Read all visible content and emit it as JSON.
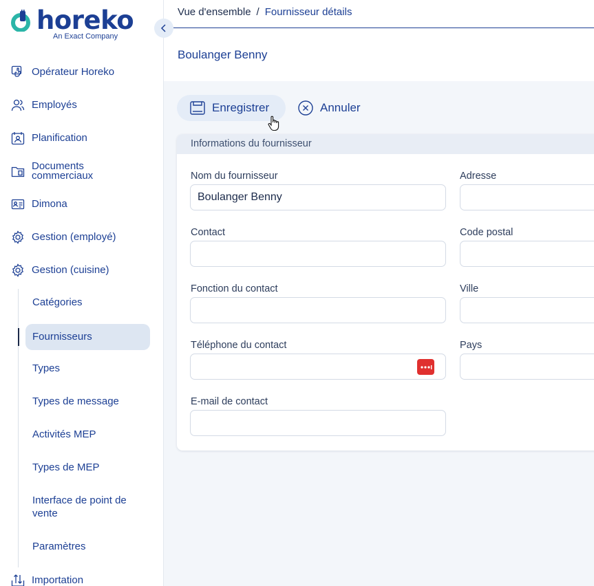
{
  "brand": {
    "name": "horeko",
    "tagline": "An Exact Company",
    "primary_color": "#1c3f94",
    "accent_color": "#2bb5a8"
  },
  "sidebar": {
    "items": [
      {
        "label": "Opérateur Horeko",
        "icon": "touch-icon"
      },
      {
        "label": "Employés",
        "icon": "users-icon"
      },
      {
        "label": "Planification",
        "icon": "calendar-user-icon"
      },
      {
        "label": "Documents commerciaux",
        "icon": "folder-icon"
      },
      {
        "label": "Dimona",
        "icon": "id-card-icon"
      },
      {
        "label": "Gestion (employé)",
        "icon": "user-gear-icon"
      },
      {
        "label": "Gestion (cuisine)",
        "icon": "chef-gear-icon"
      }
    ],
    "subitems": [
      {
        "label": "Catégories"
      },
      {
        "label": "Fournisseurs",
        "active": true
      },
      {
        "label": "Types"
      },
      {
        "label": "Types de message"
      },
      {
        "label": "Activités MEP"
      },
      {
        "label": "Types de MEP"
      },
      {
        "label": "Interface de point de vente"
      },
      {
        "label": "Paramètres"
      }
    ],
    "bottom_item": {
      "label": "Importation",
      "icon": "import-arrows-icon"
    }
  },
  "breadcrumb": {
    "root": "Vue d'ensemble",
    "separator": "/",
    "current": "Fournisseur détails"
  },
  "page": {
    "title": "Boulanger Benny"
  },
  "actions": {
    "save": "Enregistrer",
    "cancel": "Annuler"
  },
  "form": {
    "section_title": "Informations du fournisseur",
    "fields": {
      "name": {
        "label": "Nom du fournisseur",
        "value": "Boulanger Benny"
      },
      "address": {
        "label": "Adresse",
        "value": ""
      },
      "contact": {
        "label": "Contact",
        "value": ""
      },
      "postal_code": {
        "label": "Code postal",
        "value": ""
      },
      "contact_function": {
        "label": "Fonction du contact",
        "value": ""
      },
      "city": {
        "label": "Ville",
        "value": ""
      },
      "contact_phone": {
        "label": "Téléphone du contact",
        "value": ""
      },
      "country": {
        "label": "Pays",
        "value": ""
      },
      "contact_email": {
        "label": "E-mail de contact",
        "value": ""
      }
    }
  },
  "colors": {
    "password_manager": "#e0302f",
    "active_bg": "#dde6f2"
  }
}
